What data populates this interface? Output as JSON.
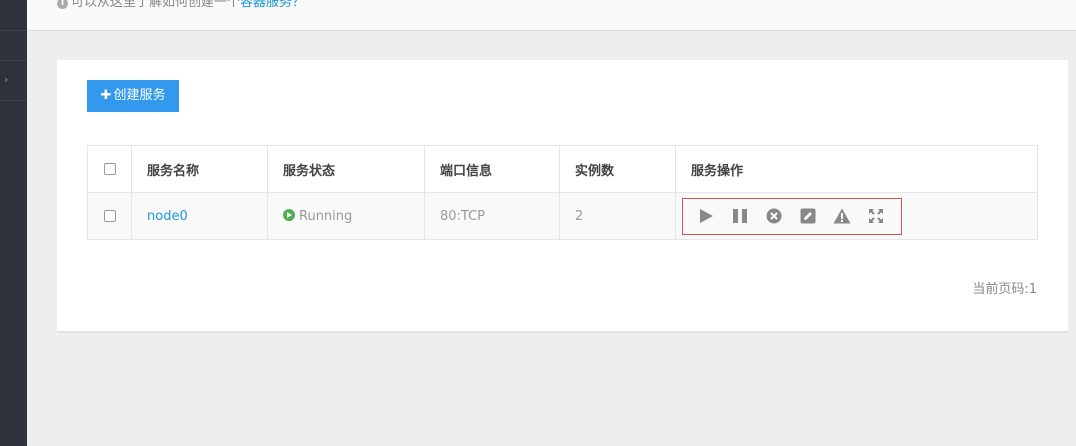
{
  "tip": {
    "prefix": "可以从这里了解如何创建一个",
    "link": "容器服务？"
  },
  "toolbar": {
    "create_label": "创建服务"
  },
  "table": {
    "headers": [
      "服务名称",
      "服务状态",
      "端口信息",
      "实例数",
      "服务操作"
    ],
    "rows": [
      {
        "name": "node0",
        "status": "Running",
        "port": "80:TCP",
        "instances": "2"
      }
    ]
  },
  "row_actions": [
    "play-icon",
    "pause-icon",
    "remove-circle-icon",
    "edit-icon",
    "warning-icon",
    "fullscreen-icon"
  ],
  "pager": {
    "label": "当前页码:1"
  },
  "colors": {
    "accent": "#3399ee",
    "link": "#1a9ad6",
    "running": "#4cae4c",
    "highlight_box": "#d9534f",
    "sidebar": "#2f323b"
  }
}
